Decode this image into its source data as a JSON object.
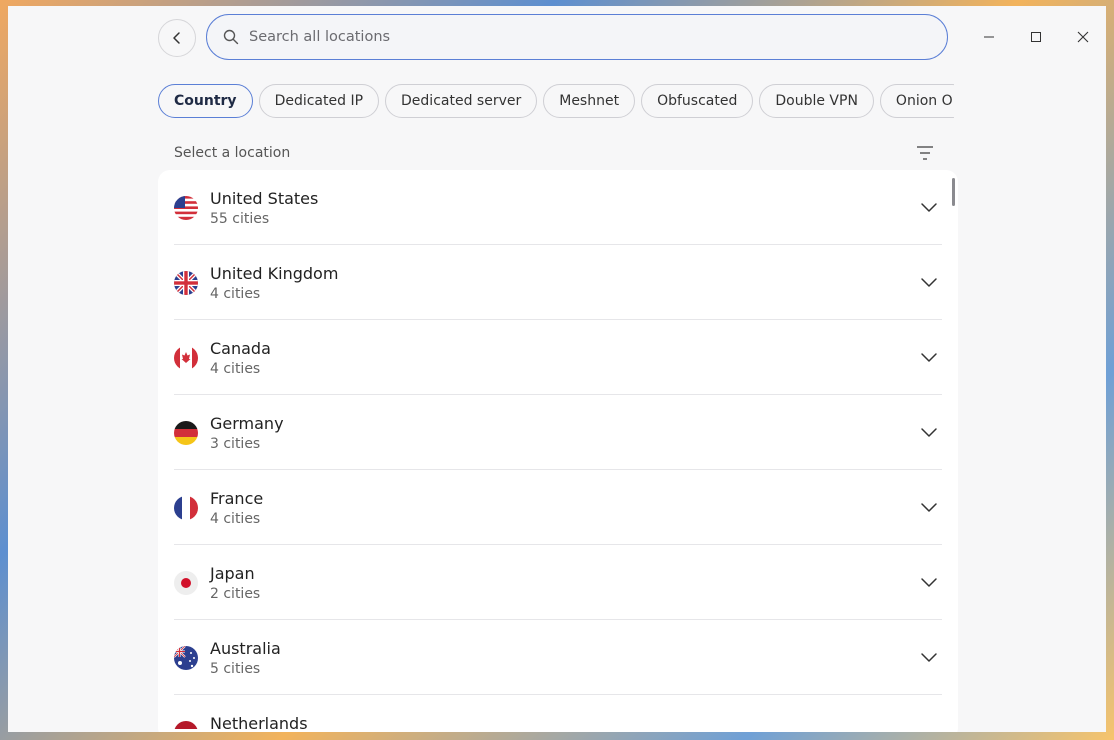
{
  "search": {
    "placeholder": "Search all locations",
    "value": ""
  },
  "chips": [
    "Country",
    "Dedicated IP",
    "Dedicated server",
    "Meshnet",
    "Obfuscated",
    "Double VPN",
    "Onion O"
  ],
  "active_chip": "Country",
  "section_label": "Select a location",
  "countries": [
    {
      "name": "United States",
      "cities": "55 cities",
      "flag": "flag-us-icon"
    },
    {
      "name": "United Kingdom",
      "cities": "4 cities",
      "flag": "flag-uk-icon"
    },
    {
      "name": "Canada",
      "cities": "4 cities",
      "flag": "flag-ca-icon"
    },
    {
      "name": "Germany",
      "cities": "3 cities",
      "flag": "flag-de-icon"
    },
    {
      "name": "France",
      "cities": "4 cities",
      "flag": "flag-fr-icon"
    },
    {
      "name": "Japan",
      "cities": "2 cities",
      "flag": "flag-jp-icon"
    },
    {
      "name": "Australia",
      "cities": "5 cities",
      "flag": "flag-au-icon"
    },
    {
      "name": "Netherlands",
      "cities": "",
      "flag": "flag-nl-icon"
    }
  ],
  "colors": {
    "accent": "#5b7fd6",
    "background": "#f7f7f8"
  }
}
